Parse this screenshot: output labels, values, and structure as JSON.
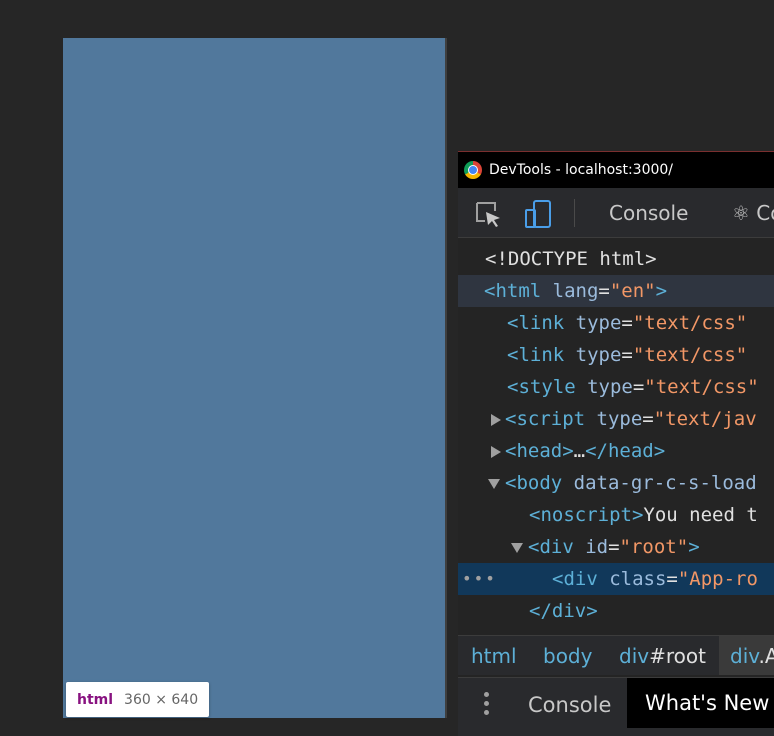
{
  "emulated_viewport": {
    "color": "#51789c",
    "tooltip": {
      "tag": "html",
      "dimensions": "360 × 640"
    }
  },
  "devtools": {
    "window_title": "DevTools - localhost:3000/",
    "toolbar": {
      "inspect_icon": "inspect-element-icon",
      "device_icon": "device-toolbar-icon",
      "tabs": [
        "Console",
        "⚛ Co"
      ]
    },
    "elements": {
      "lines": [
        {
          "parts": [
            [
              "x",
              "<!DOCTYPE html>"
            ]
          ]
        },
        {
          "parts": [
            [
              "t",
              "<html"
            ],
            [
              "a",
              " lang"
            ],
            [
              "x",
              "="
            ],
            [
              "v",
              "\"en\""
            ],
            [
              "t",
              ">"
            ]
          ]
        },
        {
          "parts": [
            [
              "t",
              "<link"
            ],
            [
              "a",
              " type"
            ],
            [
              "x",
              "="
            ],
            [
              "v",
              "\"text/css\""
            ]
          ]
        },
        {
          "parts": [
            [
              "t",
              "<link"
            ],
            [
              "a",
              " type"
            ],
            [
              "x",
              "="
            ],
            [
              "v",
              "\"text/css\""
            ]
          ]
        },
        {
          "parts": [
            [
              "t",
              "<style"
            ],
            [
              "a",
              " type"
            ],
            [
              "x",
              "="
            ],
            [
              "v",
              "\"text/css\""
            ]
          ]
        },
        {
          "parts": [
            [
              "t",
              "<script"
            ],
            [
              "a",
              " type"
            ],
            [
              "x",
              "="
            ],
            [
              "v",
              "\"text/jav"
            ]
          ]
        },
        {
          "parts": [
            [
              "t",
              "<head>"
            ],
            [
              "x",
              "…"
            ],
            [
              "t",
              "</head>"
            ]
          ]
        },
        {
          "parts": [
            [
              "t",
              "<body"
            ],
            [
              "a",
              " data-gr-c-s-load"
            ]
          ]
        },
        {
          "parts": [
            [
              "t",
              "<noscript>"
            ],
            [
              "x",
              "You need t"
            ]
          ]
        },
        {
          "parts": [
            [
              "t",
              "<div"
            ],
            [
              "a",
              " id"
            ],
            [
              "x",
              "="
            ],
            [
              "v",
              "\"root\""
            ],
            [
              "t",
              ">"
            ]
          ]
        },
        {
          "parts": [
            [
              "t",
              "<div"
            ],
            [
              "a",
              " class"
            ],
            [
              "x",
              "="
            ],
            [
              "v",
              "\"App-ro"
            ]
          ]
        },
        {
          "parts": [
            [
              "t",
              "</div>"
            ]
          ]
        }
      ],
      "ellipsis": "•••"
    },
    "breadcrumbs": [
      "html",
      "body",
      "div#root",
      "div.A"
    ],
    "drawer_tabs": {
      "console": "Console",
      "whats_new": "What's New"
    }
  }
}
